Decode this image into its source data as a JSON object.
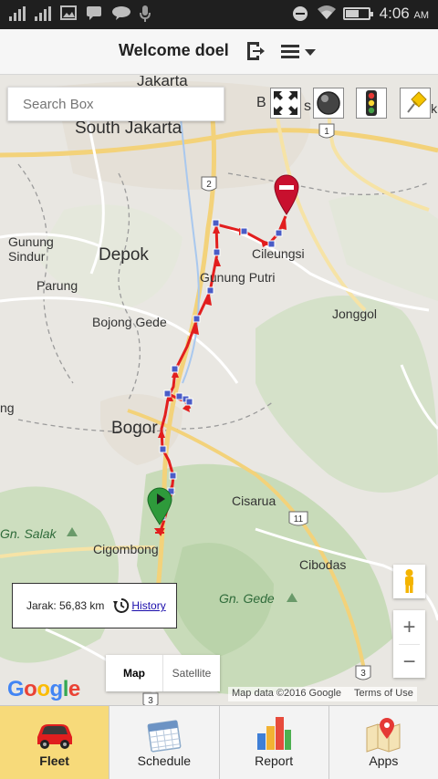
{
  "status_bar": {
    "time": "4:06",
    "ampm": "AM"
  },
  "header": {
    "title": "Welcome doel"
  },
  "search": {
    "placeholder": "Search Box"
  },
  "map": {
    "labels": {
      "jakarta": "Jakarta",
      "south_jakarta": "South Jakarta",
      "depok": "Depok",
      "gunung_sindur": "Gunung\nSindur",
      "parung": "Parung",
      "bojong_gede": "Bojong Gede",
      "bogor": "Bogor",
      "cileungsi": "Cileungsi",
      "gunung_putri": "Gunung Putri",
      "jonggol": "Jonggol",
      "cisarua": "Cisarua",
      "cibodas": "Cibodas",
      "gn_salak": "Gn. Salak",
      "gn_gede": "Gn. Gede",
      "cigombong": "Cigombong",
      "ng": "ng",
      "bks": "B",
      "bks2": "s",
      "bek": "Bek",
      "route_1": "1",
      "route_2": "2",
      "route_11": "11",
      "route_3": "3",
      "route_3b": "3"
    },
    "type_control": {
      "map": "Map",
      "satellite": "Satellite"
    },
    "attribution": {
      "data": "Map data ©2016 Google",
      "terms": "Terms of Use"
    },
    "zoom_in": "+",
    "zoom_out": "−",
    "google": [
      "G",
      "o",
      "o",
      "g",
      "l",
      "e"
    ]
  },
  "distance_box": {
    "text": "Jarak: 56,83 km",
    "history_link": "History"
  },
  "tabs": [
    {
      "label": "Fleet",
      "icon": "car-icon",
      "active": true
    },
    {
      "label": "Schedule",
      "icon": "calendar-icon",
      "active": false
    },
    {
      "label": "Report",
      "icon": "bar-chart-icon",
      "active": false
    },
    {
      "label": "Apps",
      "icon": "map-pin-icon",
      "active": false
    }
  ],
  "colors": {
    "route": "#e21e1e",
    "active_tab": "#f7da7a",
    "end_marker": "#c8102e",
    "start_marker": "#2e9a3b"
  }
}
